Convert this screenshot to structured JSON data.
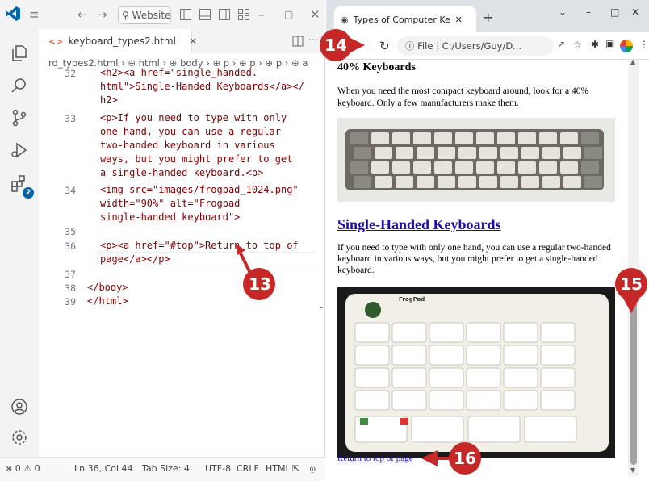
{
  "vscode": {
    "title_search": "Website",
    "tab_label": "keyboard_types2.html",
    "breadcrumb": [
      "rd_types2.html",
      "html",
      "body",
      "p",
      "p",
      "p",
      "a"
    ],
    "notification_count": "2",
    "lines": [
      {
        "num": "32",
        "rows": [
          "<h2><a href=\"single_handed.",
          "html\">Single-Handed Keyboards</a></",
          "h2>"
        ]
      },
      {
        "num": "33",
        "rows": [
          "<p>If you need to type with only",
          "one hand, you can use a regular",
          "two-handed keyboard in various",
          "ways, but you might prefer to get",
          "a single-handed keyboard.<p>"
        ]
      },
      {
        "num": "34",
        "rows": [
          "<img src=\"images/frogpad_1024.png\"",
          "width=\"90%\" alt=\"Frogpad",
          "single-handed keyboard\">"
        ]
      },
      {
        "num": "35",
        "rows": [
          ""
        ]
      },
      {
        "num": "36",
        "rows": [
          "<p><a href=\"#top\">Return to top of",
          "page</a></p>"
        ]
      },
      {
        "num": "37",
        "rows": [
          ""
        ]
      },
      {
        "num": "38",
        "rows": [
          "</body>"
        ]
      },
      {
        "num": "39",
        "rows": [
          "</html>"
        ]
      }
    ],
    "status": {
      "errors": "0",
      "warnings": "0",
      "position": "Ln 36, Col 44",
      "tab_size": "Tab Size: 4",
      "encoding": "UTF-8",
      "eol": "CRLF",
      "language": "HTML"
    }
  },
  "browser": {
    "tab_title": "Types of Computer Keyboard",
    "address_scheme": "File",
    "address": "C:/Users/Guy/D...",
    "content": {
      "heading_40": "40% Keyboards",
      "para_40": "When you need the most compact keyboard around, look for a 40% keyboard. Only a few manufacturers make them.",
      "heading_single": "Single-Handed Keyboards",
      "para_single": "If you need to type with only one hand, you can use a regular two-handed keyboard in various ways, but you might prefer to get a single-handed keyboard.",
      "frogpad_label": "FrogPad",
      "return_link": "Return to top of page"
    }
  },
  "callouts": {
    "c13": "13",
    "c14": "14",
    "c15": "15",
    "c16": "16"
  },
  "colors": {
    "callout": "#c62828",
    "link": "#1a0dab",
    "vscode_blue": "#0065a9"
  }
}
